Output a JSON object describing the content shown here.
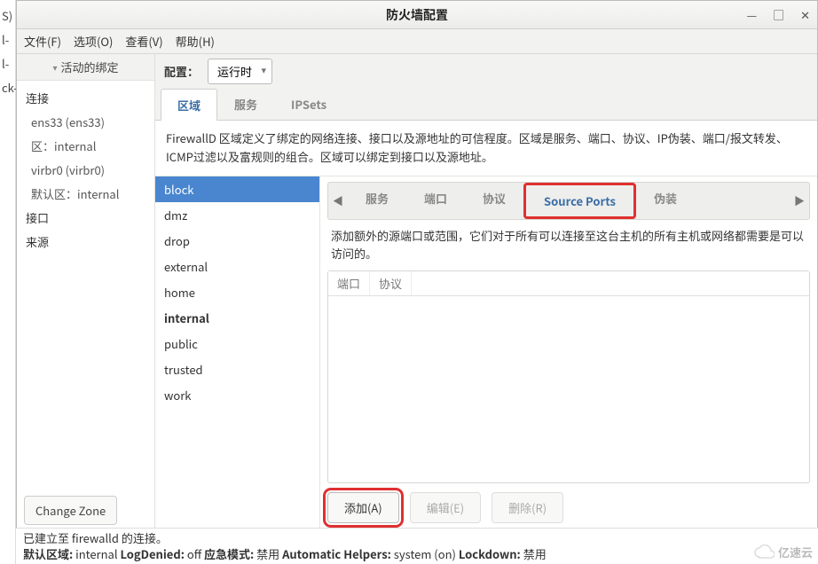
{
  "gutter": {
    "l1": "S)",
    "l2": "l-",
    "l3": "l-",
    "l4": "ck-"
  },
  "title": "防火墙配置",
  "winbtns": {
    "min": "—",
    "max": "□",
    "close": "✕"
  },
  "menubar": {
    "file": "文件(F)",
    "options": "选项(O)",
    "view": "查看(V)",
    "help": "帮助(H)"
  },
  "sidebar": {
    "header": "活动的绑定",
    "groups": [
      {
        "label": "连接",
        "items": [
          {
            "name": "ens33 (ens33)",
            "zone": "区：internal"
          },
          {
            "name": "virbr0 (virbr0)",
            "zone": "默认区：internal"
          }
        ]
      },
      {
        "label": "接口",
        "items": []
      },
      {
        "label": "来源",
        "items": []
      }
    ],
    "change_btn": "Change Zone"
  },
  "config": {
    "label": "配置：",
    "value": "运行时"
  },
  "tabs1": [
    "区域",
    "服务",
    "IPSets"
  ],
  "tabs1_active": 0,
  "zone_desc": "FirewallD 区域定义了绑定的网络连接、接口以及源地址的可信程度。区域是服务、端口、协议、IP伪装、端口/报文转发、ICMP过滤以及富规则的组合。区域可以绑定到接口以及源地址。",
  "zones": [
    "block",
    "dmz",
    "drop",
    "external",
    "home",
    "internal",
    "public",
    "trusted",
    "work"
  ],
  "zone_selected": 0,
  "zone_bold": 5,
  "tabs2": [
    "服务",
    "端口",
    "协议",
    "Source Ports",
    "伪装"
  ],
  "tabs2_active": 3,
  "source_ports_desc": "添加额外的源端口或范围，它们对于所有可以连接至这台主机的所有主机或网络都需要是可以访问的。",
  "table": {
    "cols": [
      "端口",
      "协议"
    ],
    "rows": []
  },
  "buttons": {
    "add": "添加(A)",
    "edit": "编辑(E)",
    "remove": "删除(R)"
  },
  "status": {
    "line1": "已建立至 firewalld 的连接。",
    "line2_parts": {
      "default_zone_lbl": "默认区域:",
      "default_zone": " internal  ",
      "logdenied_lbl": "LogDenied:",
      "logdenied": " off   ",
      "panic_lbl": "应急模式:",
      "panic": " 禁用  ",
      "auto_lbl": "Automatic Helpers:",
      "auto": " system (on)  ",
      "lockdown_lbl": "Lockdown:",
      "lockdown": " 禁用"
    }
  },
  "watermark": "亿速云"
}
